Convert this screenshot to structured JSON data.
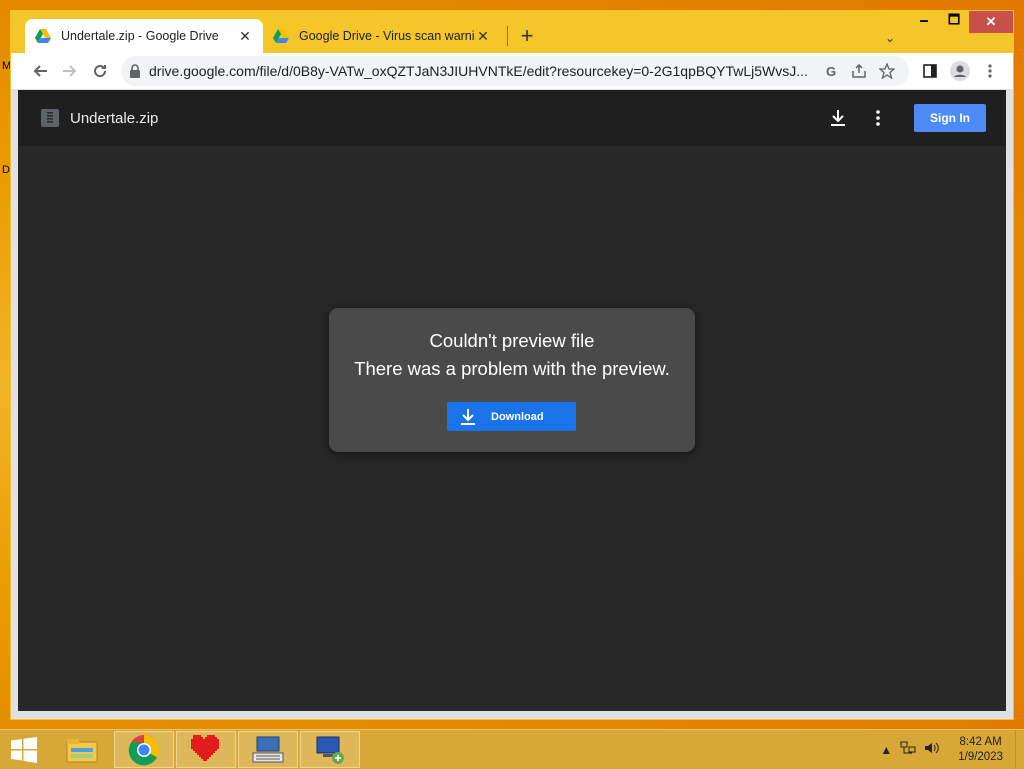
{
  "desktop": {
    "label_1": "M",
    "label_2": "D"
  },
  "window": {
    "controls": {
      "minimize": "🗕",
      "maximize": "🗖",
      "close": "✕"
    }
  },
  "tabs": [
    {
      "title": "Undertale.zip - Google Drive",
      "icon": "google-drive-icon",
      "active": true
    },
    {
      "title": "Google Drive - Virus scan warning",
      "icon": "google-drive-icon",
      "active": false
    }
  ],
  "toolbar": {
    "url": "drive.google.com/file/d/0B8y-VATw_oxQZTJaN3JIUHVNTkE/edit?resourcekey=0-2G1qpBQYTwLj5WvsJ..."
  },
  "viewer": {
    "file_name": "Undertale.zip",
    "sign_in_label": "Sign In",
    "error_title": "Couldn't preview file",
    "error_message": "There was a problem with the preview.",
    "download_label": "Download"
  },
  "taskbar": {
    "apps": [
      "file-explorer-icon",
      "chrome-icon",
      "undertale-heart-icon",
      "keyboard-app-icon",
      "network-app-icon"
    ],
    "time": "8:42 AM",
    "date": "1/9/2023"
  },
  "colors": {
    "accent_blue": "#1a73e8",
    "signin_blue": "#4c8bf5",
    "window_frame": "#f5c62a",
    "viewer_bg": "#282828"
  }
}
